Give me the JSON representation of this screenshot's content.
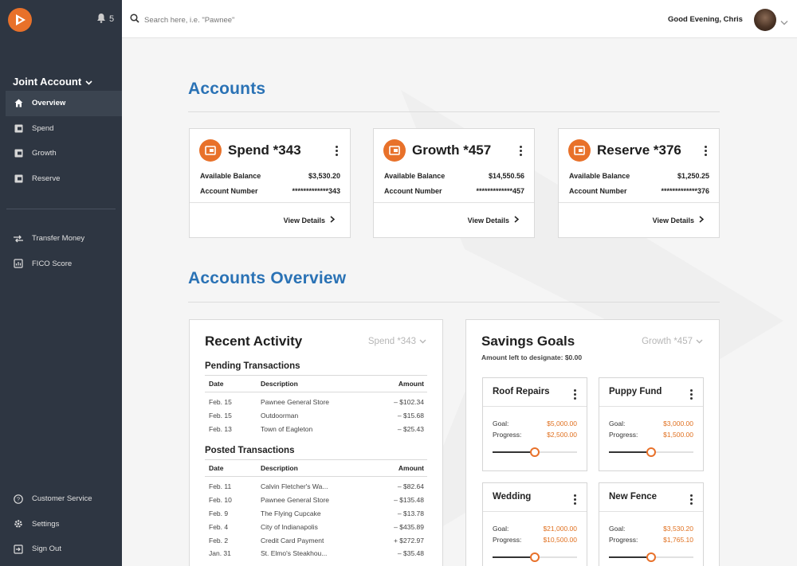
{
  "colors": {
    "accent": "#e8712a",
    "heading": "#2a72b5",
    "sidebar": "#2e3642"
  },
  "sidebar": {
    "notification_count": "5",
    "account_switch": "Joint Account",
    "nav": [
      {
        "label": "Overview",
        "icon": "home-icon"
      },
      {
        "label": "Spend",
        "icon": "wallet-icon"
      },
      {
        "label": "Growth",
        "icon": "wallet-icon"
      },
      {
        "label": "Reserve",
        "icon": "wallet-icon"
      }
    ],
    "tools": [
      {
        "label": "Transfer Money",
        "icon": "transfer-icon"
      },
      {
        "label": "FICO Score",
        "icon": "score-icon"
      }
    ],
    "footer": [
      {
        "label": "Customer Service",
        "icon": "help-icon"
      },
      {
        "label": "Settings",
        "icon": "gear-icon"
      },
      {
        "label": "Sign Out",
        "icon": "sign-out-icon"
      }
    ]
  },
  "topbar": {
    "search_placeholder": "Search here, i.e. \"Pawnee\"",
    "greeting": "Good Evening, Chris"
  },
  "main": {
    "accounts_title": "Accounts",
    "overview_title": "Accounts Overview",
    "accounts": [
      {
        "name": "Spend *343",
        "balance_label": "Available Balance",
        "balance": "$3,530.20",
        "number_label": "Account Number",
        "number": "*************343",
        "view_label": "View Details"
      },
      {
        "name": "Growth *457",
        "balance_label": "Available Balance",
        "balance": "$14,550.56",
        "number_label": "Account Number",
        "number": "*************457",
        "view_label": "View Details"
      },
      {
        "name": "Reserve *376",
        "balance_label": "Available Balance",
        "balance": "$1,250.25",
        "number_label": "Account Number",
        "number": "*************376",
        "view_label": "View Details"
      }
    ],
    "recent_activity": {
      "title": "Recent Activity",
      "account_select": "Spend *343",
      "pending_title": "Pending Transactions",
      "posted_title": "Posted Transactions",
      "columns": [
        "Date",
        "Description",
        "Amount"
      ],
      "pending": [
        [
          "Feb. 15",
          "Pawnee General Store",
          "– $102.34"
        ],
        [
          "Feb. 15",
          "Outdoorman",
          "– $15.68"
        ],
        [
          "Feb. 13",
          "Town of Eagleton",
          "– $25.43"
        ]
      ],
      "posted": [
        [
          "Feb. 11",
          "Calvin Fletcher's Wa...",
          "– $82.64"
        ],
        [
          "Feb. 10",
          "Pawnee General Store",
          "– $135.48"
        ],
        [
          "Feb. 9",
          "The Flying Cupcake",
          "– $13.78"
        ],
        [
          "Feb. 4",
          "City of Indianapolis",
          "– $435.89"
        ],
        [
          "Feb. 2",
          "Credit Card Payment",
          "+ $272.97"
        ],
        [
          "Jan. 31",
          "St. Elmo's Steakhou...",
          "– $35.48"
        ]
      ]
    },
    "savings_goals": {
      "title": "Savings Goals",
      "account_select": "Growth *457",
      "subtitle": "Amount left to designate: $0.00",
      "goal_label": "Goal:",
      "progress_label": "Progress:",
      "goals": [
        {
          "name": "Roof Repairs",
          "goal": "$5,000.00",
          "progress": "$2,500.00",
          "fraction": 0.5
        },
        {
          "name": "Puppy Fund",
          "goal": "$3,000.00",
          "progress": "$1,500.00",
          "fraction": 0.5
        },
        {
          "name": "Wedding",
          "goal": "$21,000.00",
          "progress": "$10,500.00",
          "fraction": 0.5
        },
        {
          "name": "New Fence",
          "goal": "$3,530.20",
          "progress": "$1,765.10",
          "fraction": 0.5
        }
      ]
    }
  }
}
